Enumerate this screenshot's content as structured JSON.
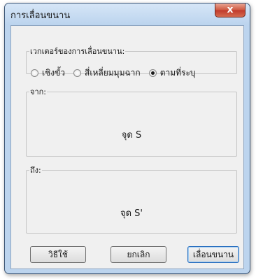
{
  "window": {
    "title": "การเลื่อนขนาน",
    "close_glyph": "x"
  },
  "vector_group": {
    "legend": "เวกเตอร์ของการเลื่อนขนาน:",
    "options": [
      {
        "label": "เชิงขั้ว",
        "selected": false
      },
      {
        "label": "สี่เหลี่ยมมุมฉาก",
        "selected": false
      },
      {
        "label": "ตามที่ระบุ",
        "selected": true
      }
    ]
  },
  "from_group": {
    "legend": "จาก:",
    "value": "จุด S"
  },
  "to_group": {
    "legend": "ถึง:",
    "value": "จุด S'"
  },
  "buttons": {
    "help": "วิธีใช้",
    "cancel": "ยกเลิก",
    "translate": "เลื่อนขนาน"
  }
}
